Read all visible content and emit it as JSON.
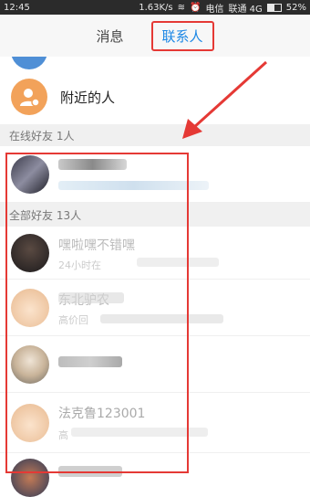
{
  "status_bar": {
    "time": "12:45",
    "network_speed": "1.63K/s",
    "carrier_1": "电信",
    "carrier_2": "联通 4G",
    "battery": "52%",
    "battery_level": 0.52
  },
  "header": {
    "tabs": [
      {
        "label": "消息",
        "active": false
      },
      {
        "label": "联系人",
        "active": true
      }
    ]
  },
  "nearby": {
    "label": "附近的人"
  },
  "sections": {
    "online": "在线好友 1人",
    "all": "全部好友 13人"
  },
  "contacts": [
    {
      "name": "",
      "status": ""
    },
    {
      "name": "嘿啦嘿不错嘿",
      "status": "24小时在"
    },
    {
      "name": "东北驴农",
      "status": "高价回"
    },
    {
      "name": "",
      "status": ""
    },
    {
      "name": "法克鲁123001",
      "status": "高"
    },
    {
      "name": "",
      "status": ""
    }
  ],
  "colors": {
    "accent": "#1e88e5",
    "highlight": "#e53935",
    "nearby_avatar": "#f2a25a"
  }
}
